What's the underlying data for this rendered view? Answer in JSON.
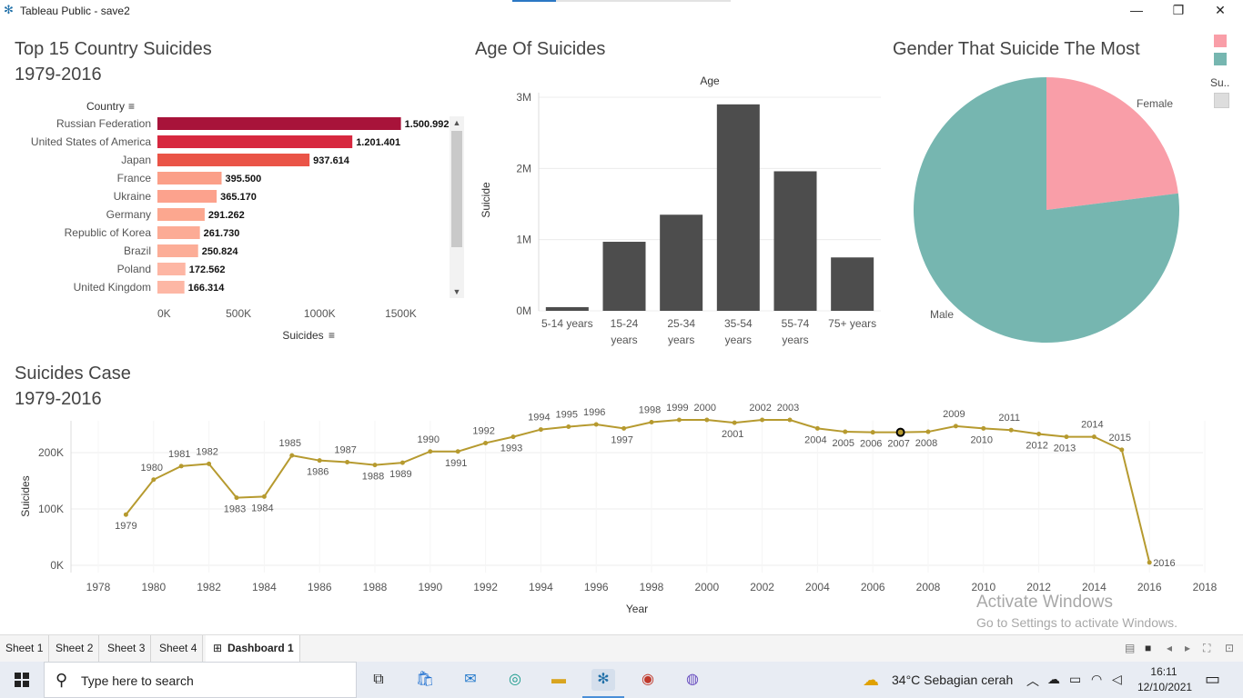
{
  "window": {
    "title": "Tableau Public - save2",
    "minimize": "—",
    "restore": "❐",
    "close": "✕"
  },
  "top15": {
    "title1": "Top 15 Country Suicides",
    "title2": "1979-2016",
    "row_header": "Country",
    "axis_title": "Suicides",
    "ticks": [
      "0K",
      "500K",
      "1000K",
      "1500K"
    ],
    "tick_values": [
      0,
      500000,
      1000000,
      1500000
    ],
    "axis_max": 1750000,
    "rows": [
      {
        "country": "Russian Federation",
        "label": "1.500.992",
        "value": 1500992,
        "color": "#a8133a"
      },
      {
        "country": "United States of America",
        "label": "1.201.401",
        "value": 1201401,
        "color": "#d7283f"
      },
      {
        "country": "Japan",
        "label": "937.614",
        "value": 937614,
        "color": "#ea5447"
      },
      {
        "country": "France",
        "label": "395.500",
        "value": 395500,
        "color": "#fb9f88"
      },
      {
        "country": "Ukraine",
        "label": "365.170",
        "value": 365170,
        "color": "#fca28d"
      },
      {
        "country": "Germany",
        "label": "291.262",
        "value": 291262,
        "color": "#fca78f"
      },
      {
        "country": "Republic of Korea",
        "label": "261.730",
        "value": 261730,
        "color": "#fcab95"
      },
      {
        "country": "Brazil",
        "label": "250.824",
        "value": 250824,
        "color": "#fcad97"
      },
      {
        "country": "Poland",
        "label": "172.562",
        "value": 172562,
        "color": "#fdb6a4"
      },
      {
        "country": "United Kingdom",
        "label": "166.314",
        "value": 166314,
        "color": "#fdb7a5"
      }
    ]
  },
  "age": {
    "title": "Age Of Suicides",
    "column_header": "Age",
    "axis_title": "Suicide",
    "ticks": [
      "0M",
      "1M",
      "2M",
      "3M"
    ],
    "tick_values": [
      0,
      1000000,
      2000000,
      3000000
    ],
    "axis_max": 3000000,
    "bar_color": "#4d4d4d",
    "bars": [
      {
        "l1": "5-14 years",
        "l2": "",
        "value": 52000
      },
      {
        "l1": "15-24",
        "l2": "years",
        "value": 970000
      },
      {
        "l1": "25-34",
        "l2": "years",
        "value": 1350000
      },
      {
        "l1": "35-54",
        "l2": "years",
        "value": 2900000
      },
      {
        "l1": "55-74",
        "l2": "years",
        "value": 1960000
      },
      {
        "l1": "75+ years",
        "l2": "",
        "value": 750000
      }
    ]
  },
  "gender": {
    "title": "Gender That Suicide The Most",
    "slices": [
      {
        "name": "Female",
        "share": 0.23,
        "color": "#f99ea8"
      },
      {
        "name": "Male",
        "share": 0.77,
        "color": "#76b6b0"
      }
    ],
    "legend_cut_label": "Su.."
  },
  "trend": {
    "title1": "Suicides Case",
    "title2": "1979-2016",
    "axis_title_y": "Suicides",
    "axis_title_x": "Year",
    "y_ticks": [
      "0K",
      "100K",
      "200K"
    ],
    "y_tick_values": [
      0,
      100000,
      200000
    ],
    "x_ticks": [
      "1978",
      "1980",
      "1982",
      "1984",
      "1986",
      "1988",
      "1990",
      "1992",
      "1994",
      "1996",
      "1998",
      "2000",
      "2002",
      "2004",
      "2006",
      "2008",
      "2010",
      "2012",
      "2014",
      "2016",
      "2018"
    ],
    "line_color": "#b69a2f",
    "highlight_year": 2007,
    "points": [
      {
        "year": 1979,
        "value": 90000
      },
      {
        "year": 1980,
        "value": 152000
      },
      {
        "year": 1981,
        "value": 176000
      },
      {
        "year": 1982,
        "value": 180000
      },
      {
        "year": 1983,
        "value": 120000
      },
      {
        "year": 1984,
        "value": 122000
      },
      {
        "year": 1985,
        "value": 195000
      },
      {
        "year": 1986,
        "value": 186000
      },
      {
        "year": 1987,
        "value": 183000
      },
      {
        "year": 1988,
        "value": 178000
      },
      {
        "year": 1989,
        "value": 182000
      },
      {
        "year": 1990,
        "value": 202000
      },
      {
        "year": 1991,
        "value": 202000
      },
      {
        "year": 1992,
        "value": 217000
      },
      {
        "year": 1993,
        "value": 228000
      },
      {
        "year": 1994,
        "value": 241000
      },
      {
        "year": 1995,
        "value": 246000
      },
      {
        "year": 1996,
        "value": 250000
      },
      {
        "year": 1997,
        "value": 243000
      },
      {
        "year": 1998,
        "value": 254000
      },
      {
        "year": 1999,
        "value": 258000
      },
      {
        "year": 2000,
        "value": 258000
      },
      {
        "year": 2001,
        "value": 253000
      },
      {
        "year": 2002,
        "value": 258000
      },
      {
        "year": 2003,
        "value": 258000
      },
      {
        "year": 2004,
        "value": 243000
      },
      {
        "year": 2005,
        "value": 237000
      },
      {
        "year": 2006,
        "value": 236000
      },
      {
        "year": 2007,
        "value": 236000
      },
      {
        "year": 2008,
        "value": 237000
      },
      {
        "year": 2009,
        "value": 247000
      },
      {
        "year": 2010,
        "value": 243000
      },
      {
        "year": 2011,
        "value": 240000
      },
      {
        "year": 2012,
        "value": 233000
      },
      {
        "year": 2013,
        "value": 228000
      },
      {
        "year": 2014,
        "value": 228000
      },
      {
        "year": 2015,
        "value": 205000
      },
      {
        "year": 2016,
        "value": 5000
      }
    ]
  },
  "watermark": {
    "line1": "Activate Windows",
    "line2": "Go to Settings to activate Windows."
  },
  "tabs": [
    "Sheet 1",
    "Sheet 2",
    "Sheet 3",
    "Sheet 4",
    "Dashboard 1"
  ],
  "taskbar": {
    "search_placeholder": "Type here to search",
    "weather": "34°C  Sebagian cerah",
    "time": "16:11",
    "date": "12/10/2021"
  }
}
